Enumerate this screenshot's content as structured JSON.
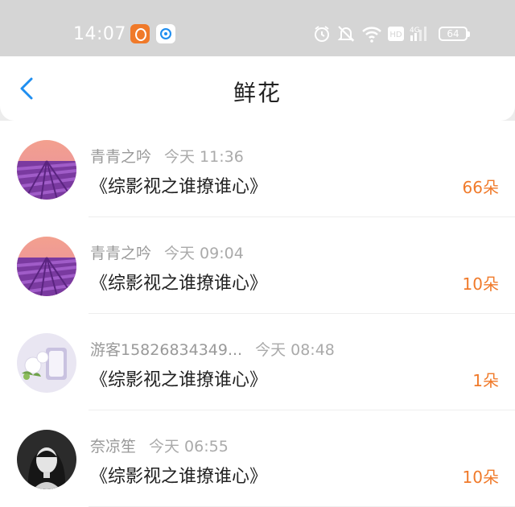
{
  "status_bar": {
    "time": "14:07",
    "icons": [
      "taobao-app-icon",
      "blue-app-icon",
      "alarm-icon",
      "mute-icon",
      "wifi-icon",
      "hd-icon",
      "4g-signal-icon",
      "battery-icon"
    ],
    "hd_label": "HD",
    "net_label": "4G",
    "battery": "64"
  },
  "header": {
    "title": "鲜花",
    "back_icon": "chevron-left-icon",
    "accent_color": "#1f8ef0"
  },
  "rows": [
    {
      "user": "青青之吟",
      "time": "今天 11:36",
      "book": "《综影视之谁撩谁心》",
      "count": "66朵",
      "avatar": "lavender-field"
    },
    {
      "user": "青青之吟",
      "time": "今天 09:04",
      "book": "《综影视之谁撩谁心》",
      "count": "10朵",
      "avatar": "lavender-field"
    },
    {
      "user": "游客15826834349...",
      "time": "今天 08:48",
      "book": "《综影视之谁撩谁心》",
      "count": "1朵",
      "avatar": "white-flowers"
    },
    {
      "user": "奈凉笙",
      "time": "今天 06:55",
      "book": "《综影视之谁撩谁心》",
      "count": "10朵",
      "avatar": "portrait-photo"
    }
  ],
  "colors": {
    "count": "#f07a2a",
    "status_bar": "#d5d5d5"
  }
}
